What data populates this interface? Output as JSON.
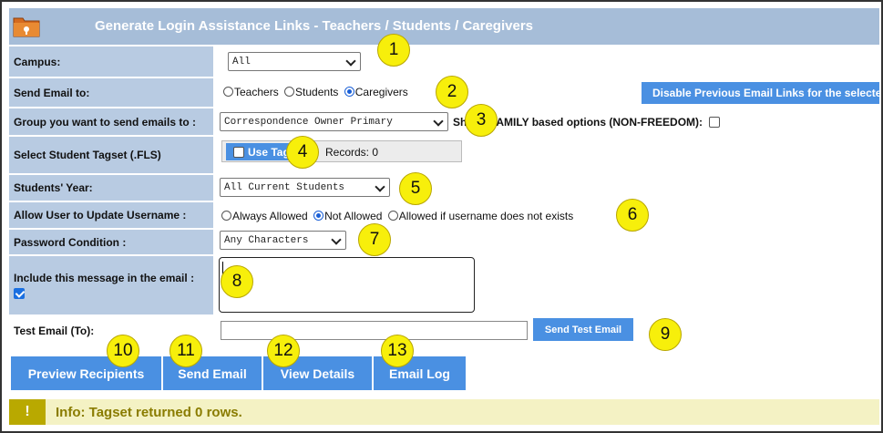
{
  "header": {
    "title": "Generate Login Assistance Links - Teachers / Students / Caregivers"
  },
  "campus": {
    "label": "Campus:",
    "value": "All"
  },
  "send_email": {
    "label": "Send Email to:",
    "options": [
      "Teachers",
      "Students",
      "Caregivers"
    ],
    "selected": "Caregivers",
    "disable_button": "Disable Previous Email Links for the selected"
  },
  "group": {
    "label": "Group you want to send emails to :",
    "value": "Correspondence Owner Primary",
    "family_prefix": "Sh",
    "family_suffix": "AMILY based options (NON-FREEDOM):"
  },
  "tagset": {
    "label": "Select Student Tagset (.FLS)",
    "use_tag": "Use Tag",
    "records": "Records:  0"
  },
  "students_year": {
    "label": "Students' Year:",
    "value": "All Current Students"
  },
  "update_username": {
    "label": "Allow User to Update Username :",
    "options": [
      "Always Allowed",
      "Not Allowed",
      "Allowed if username does not exists"
    ],
    "selected": "Not Allowed"
  },
  "password": {
    "label": "Password Condition :",
    "value": "Any Characters"
  },
  "message": {
    "label": "Include this message in the email :"
  },
  "test_email": {
    "label": "Test Email (To):",
    "button": "Send Test Email"
  },
  "actions": {
    "preview": "Preview Recipients",
    "send": "Send Email",
    "details": "View Details",
    "log": "Email Log"
  },
  "info": {
    "bang": "!",
    "text": "Info: Tagset returned 0 rows."
  },
  "callouts": [
    "1",
    "2",
    "3",
    "4",
    "5",
    "6",
    "7",
    "8",
    "9",
    "10",
    "11",
    "12",
    "13"
  ],
  "colors": {
    "header_bg": "#a6bdd8",
    "label_bg": "#b8cbe2",
    "button_blue": "#4a90e2",
    "callout_yellow": "#f7ef0b"
  },
  "icons": {
    "header": "folder-icon"
  }
}
